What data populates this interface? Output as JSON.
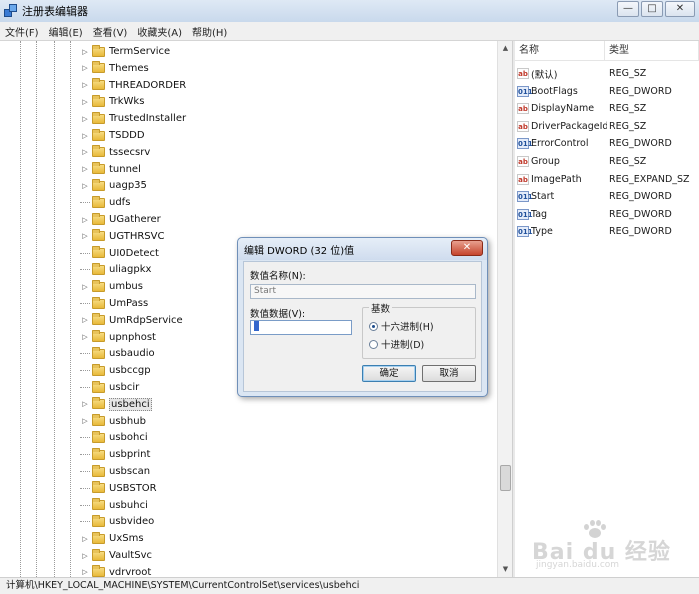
{
  "window": {
    "title": "注册表编辑器",
    "minimize": "—",
    "maximize": "□",
    "close": "✕"
  },
  "menu": [
    "文件(F)",
    "编辑(E)",
    "查看(V)",
    "收藏夹(A)",
    "帮助(H)"
  ],
  "tree": {
    "items": [
      {
        "label": "TermService",
        "expandable": true
      },
      {
        "label": "Themes",
        "expandable": true
      },
      {
        "label": "THREADORDER",
        "expandable": true
      },
      {
        "label": "TrkWks",
        "expandable": true
      },
      {
        "label": "TrustedInstaller",
        "expandable": true
      },
      {
        "label": "TSDDD",
        "expandable": true
      },
      {
        "label": "tssecsrv",
        "expandable": true
      },
      {
        "label": "tunnel",
        "expandable": true
      },
      {
        "label": "uagp35",
        "expandable": true
      },
      {
        "label": "udfs",
        "expandable": false
      },
      {
        "label": "UGatherer",
        "expandable": true
      },
      {
        "label": "UGTHRSVC",
        "expandable": true
      },
      {
        "label": "UI0Detect",
        "expandable": false
      },
      {
        "label": "uliagpkx",
        "expandable": false
      },
      {
        "label": "umbus",
        "expandable": true
      },
      {
        "label": "UmPass",
        "expandable": false
      },
      {
        "label": "UmRdpService",
        "expandable": true
      },
      {
        "label": "upnphost",
        "expandable": true
      },
      {
        "label": "usbaudio",
        "expandable": false
      },
      {
        "label": "usbccgp",
        "expandable": false
      },
      {
        "label": "usbcir",
        "expandable": false
      },
      {
        "label": "usbehci",
        "expandable": true,
        "selected": true
      },
      {
        "label": "usbhub",
        "expandable": true
      },
      {
        "label": "usbohci",
        "expandable": false
      },
      {
        "label": "usbprint",
        "expandable": false
      },
      {
        "label": "usbscan",
        "expandable": false
      },
      {
        "label": "USBSTOR",
        "expandable": false
      },
      {
        "label": "usbuhci",
        "expandable": false
      },
      {
        "label": "usbvideo",
        "expandable": false
      },
      {
        "label": "UxSms",
        "expandable": true
      },
      {
        "label": "VaultSvc",
        "expandable": true
      },
      {
        "label": "vdrvroot",
        "expandable": true
      }
    ]
  },
  "values": {
    "header_name": "名称",
    "header_type": "类型",
    "rows": [
      {
        "name": "(默认)",
        "type": "REG_SZ",
        "icon": "sz"
      },
      {
        "name": "BootFlags",
        "type": "REG_DWORD",
        "icon": "dw"
      },
      {
        "name": "DisplayName",
        "type": "REG_SZ",
        "icon": "sz"
      },
      {
        "name": "DriverPackageId",
        "type": "REG_SZ",
        "icon": "sz"
      },
      {
        "name": "ErrorControl",
        "type": "REG_DWORD",
        "icon": "dw"
      },
      {
        "name": "Group",
        "type": "REG_SZ",
        "icon": "sz"
      },
      {
        "name": "ImagePath",
        "type": "REG_EXPAND_SZ",
        "icon": "sz"
      },
      {
        "name": "Start",
        "type": "REG_DWORD",
        "icon": "dw"
      },
      {
        "name": "Tag",
        "type": "REG_DWORD",
        "icon": "dw"
      },
      {
        "name": "Type",
        "type": "REG_DWORD",
        "icon": "dw"
      }
    ]
  },
  "icon_glyphs": {
    "sz": "ab",
    "dw": "011"
  },
  "status": "计算机\\HKEY_LOCAL_MACHINE\\SYSTEM\\CurrentControlSet\\services\\usbehci",
  "dialog": {
    "title": "编辑 DWORD (32 位)值",
    "close_label": "✕",
    "name_label": "数值名称(N):",
    "name_value": "Start",
    "data_label": "数值数据(V):",
    "data_value": "3",
    "base_label": "基数",
    "base_hex": "十六进制(H)",
    "base_dec": "十进制(D)",
    "base_selected": "hex",
    "ok": "确定",
    "cancel": "取消"
  },
  "watermark": {
    "main": "Bai du 经验",
    "sub": "jingyan.baidu.com"
  }
}
